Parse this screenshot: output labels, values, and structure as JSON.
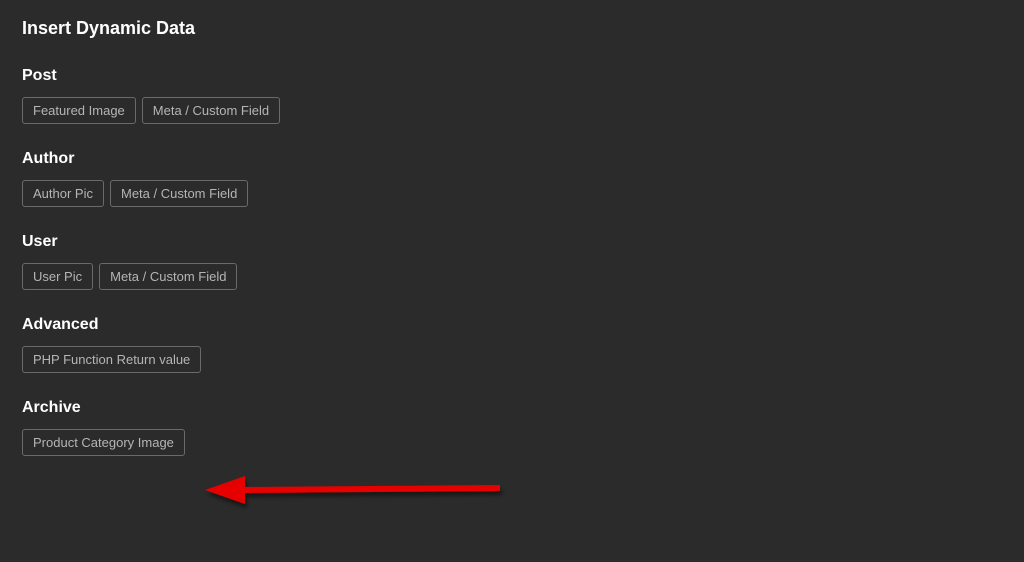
{
  "title": "Insert Dynamic Data",
  "sections": {
    "post": {
      "heading": "Post",
      "options": [
        "Featured Image",
        "Meta / Custom Field"
      ]
    },
    "author": {
      "heading": "Author",
      "options": [
        "Author Pic",
        "Meta / Custom Field"
      ]
    },
    "user": {
      "heading": "User",
      "options": [
        "User Pic",
        "Meta / Custom Field"
      ]
    },
    "advanced": {
      "heading": "Advanced",
      "options": [
        "PHP Function Return value"
      ]
    },
    "archive": {
      "heading": "Archive",
      "options": [
        "Product Category Image"
      ]
    }
  }
}
